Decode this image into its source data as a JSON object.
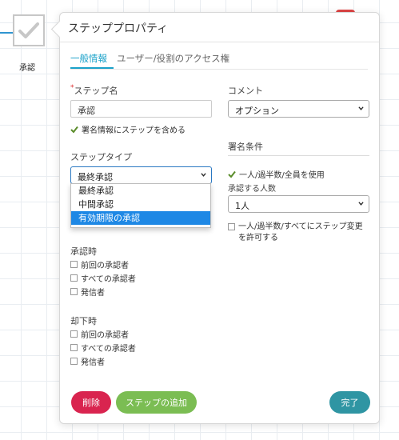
{
  "node": {
    "label": "承認"
  },
  "dialog": {
    "title": "ステッププロパティ",
    "tabs": [
      "一般情報",
      "ユーザー/役割のアクセス権"
    ]
  },
  "form": {
    "step_name": {
      "label": "ステップ名",
      "required_mark": "*",
      "value": "承認"
    },
    "include_signature": {
      "label": "署名情報にステップを含める",
      "checked": true
    },
    "comment": {
      "label": "コメント",
      "value": "オプション"
    },
    "signature_conditions": {
      "label": "署名条件"
    },
    "use_majority": {
      "label": "一人/過半数/全員を使用",
      "checked": true
    },
    "approvers_count": {
      "label": "承認する人数",
      "value": "1人"
    },
    "allow_step_change": {
      "label": "一人/過半数/すべてにステップ変更を許可する",
      "checked": false
    },
    "step_type": {
      "label": "ステップタイプ",
      "value": "最終承認",
      "options": [
        "最終承認",
        "中間承認",
        "有効期限の承認"
      ],
      "highlighted_option": "有効期限の承認"
    },
    "on_approve": {
      "label": "承認時",
      "options": [
        "前回の承認者",
        "すべての承認者",
        "発信者"
      ]
    },
    "on_reject": {
      "label": "却下時",
      "options": [
        "前回の承認者",
        "すべての承認者",
        "発信者"
      ]
    }
  },
  "buttons": {
    "delete": "削除",
    "add_step": "ステップの追加",
    "done": "完了"
  },
  "colors": {
    "accent": "#1aa1c9",
    "delete": "#d9244f",
    "add_step": "#7bbd53",
    "done": "#2f95a3",
    "dropdown_selected": "#1e88e5",
    "check": "#5a8c2a"
  }
}
